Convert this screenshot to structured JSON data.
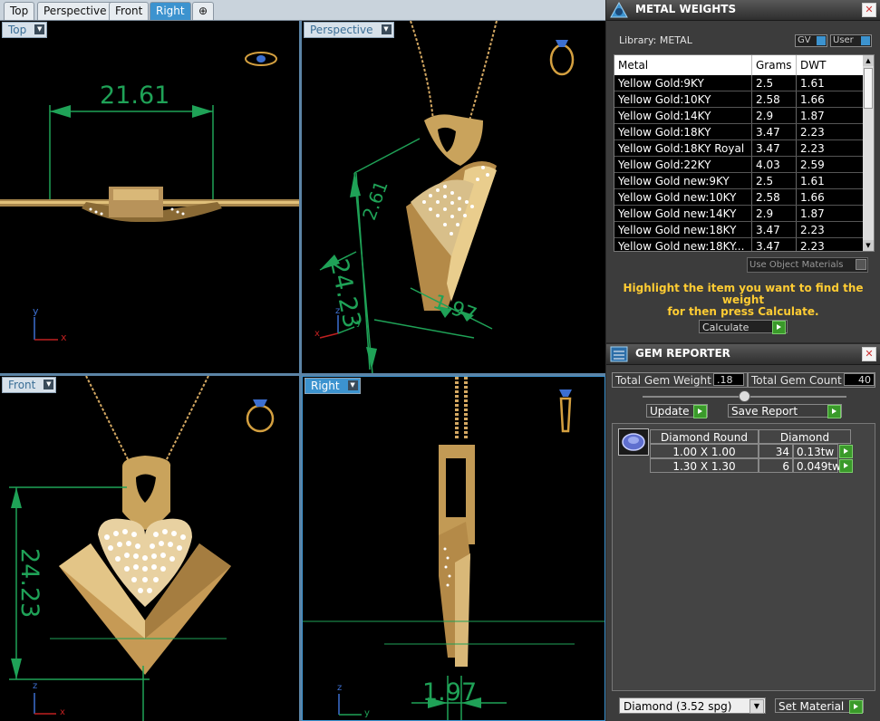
{
  "tabs": [
    {
      "label": "Top"
    },
    {
      "label": "Perspective"
    },
    {
      "label": "Front"
    },
    {
      "label": "Right"
    },
    {
      "label": "⊕"
    }
  ],
  "viewports": {
    "top": {
      "label": "Top",
      "dimension": "21.61",
      "axes": {
        "a": "y",
        "b": "x"
      }
    },
    "perspective": {
      "label": "Perspective",
      "dimension1": "24.23",
      "dimension2": "2.61",
      "dimension3": "1.97",
      "axes": {
        "a": "z",
        "b": "y",
        "c": "x"
      }
    },
    "front": {
      "label": "Front",
      "dimension": "24.23",
      "axes": {
        "a": "z",
        "b": "x"
      }
    },
    "right": {
      "label": "Right",
      "dimension": "1.97",
      "axes": {
        "a": "z",
        "b": "y"
      }
    }
  },
  "metal_weights": {
    "title": "METAL WEIGHTS",
    "library": "Library: METAL",
    "gv": "GV",
    "user": "User",
    "headers": [
      "Metal",
      "Grams",
      "DWT"
    ],
    "rows": [
      [
        "Yellow Gold:9KY",
        "2.5",
        "1.61"
      ],
      [
        "Yellow Gold:10KY",
        "2.58",
        "1.66"
      ],
      [
        "Yellow Gold:14KY",
        "2.9",
        "1.87"
      ],
      [
        "Yellow Gold:18KY",
        "3.47",
        "2.23"
      ],
      [
        "Yellow Gold:18KY Royal",
        "3.47",
        "2.23"
      ],
      [
        "Yellow Gold:22KY",
        "4.03",
        "2.59"
      ],
      [
        "Yellow Gold new:9KY",
        "2.5",
        "1.61"
      ],
      [
        "Yellow Gold new:10KY",
        "2.58",
        "1.66"
      ],
      [
        "Yellow Gold new:14KY",
        "2.9",
        "1.87"
      ],
      [
        "Yellow Gold new:18KY",
        "3.47",
        "2.23"
      ],
      [
        "Yellow Gold new:18KY...",
        "3.47",
        "2.23"
      ],
      [
        "Yellow Gold new:22KY",
        "4.03",
        "2.59"
      ]
    ],
    "use_object_materials": "Use Object Materials",
    "hint_line1": "Highlight the item you want to find the weight",
    "hint_line2": "for then press Calculate.",
    "calculate": "Calculate"
  },
  "gem_reporter": {
    "title": "GEM REPORTER",
    "total_weight_label": "Total Gem Weight",
    "total_weight": ".18",
    "total_count_label": "Total Gem Count",
    "total_count": "40",
    "update": "Update",
    "save_report": "Save Report",
    "table_headers": [
      "Diamond Round",
      "Diamond"
    ],
    "rows": [
      {
        "size": "1.00 X 1.00",
        "count": "34",
        "weight": "0.13tw"
      },
      {
        "size": "1.30 X 1.30",
        "count": "6",
        "weight": "0.049tw"
      }
    ],
    "material_select": "Diamond     (3.52 spg)",
    "set_material": "Set Material"
  },
  "colors": {
    "gold": "#d4a862",
    "dimension": "#1fa257",
    "accent": "#3c93cf",
    "hint": "#ffcc33"
  }
}
